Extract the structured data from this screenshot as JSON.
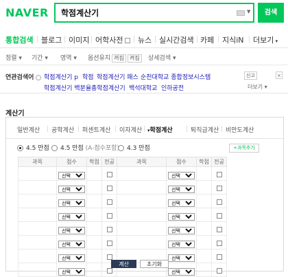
{
  "header": {
    "logo": "NAVER",
    "query": "학점계산기",
    "search_button": "검색"
  },
  "tabs": [
    "통합검색",
    "블로그",
    "이미지",
    "어학사전",
    "뉴스",
    "실시간검색",
    "카페",
    "지식iN",
    "더보기"
  ],
  "options": {
    "sort": "정렬",
    "period": "기간",
    "area": "영역",
    "keep_option": "옵션유지",
    "on": "꺼짐",
    "off": "켜짐",
    "detail": "상세검색"
  },
  "related": {
    "title": "연관검색어",
    "row1": [
      "학점계산기 p",
      "학점",
      "학점계산기 패스",
      "순천대학교 종합정보시스템"
    ],
    "row2": [
      "학점계산기 백분율",
      "총학점계산기",
      "백석대학교",
      "인하공전"
    ],
    "report": "신고",
    "more": "더보기"
  },
  "calculator": {
    "title": "계산기",
    "tabs": [
      "일반계산",
      "공학계산",
      "퍼센트계산",
      "이자계산",
      "학점계산",
      "퇴직금계산",
      "비만도계산"
    ],
    "active_tab": "학점계산",
    "scales": [
      {
        "label": "4.5 만점",
        "note": "",
        "selected": true
      },
      {
        "label": "4.5 만점",
        "note": "(A-점수포함)",
        "selected": false
      },
      {
        "label": "4.3 만점",
        "note": "",
        "selected": false
      }
    ],
    "add_button": "과목추가",
    "columns": [
      "과목",
      "점수",
      "학점",
      "전공",
      "과목",
      "점수",
      "학점",
      "전공"
    ],
    "select_default": "선택",
    "row_count": 8,
    "calc_button": "계산",
    "reset_button": "초기화"
  },
  "colors": {
    "brand": "#03c75a",
    "link": "#1a1ab8",
    "calc_button": "#2b3a55"
  }
}
